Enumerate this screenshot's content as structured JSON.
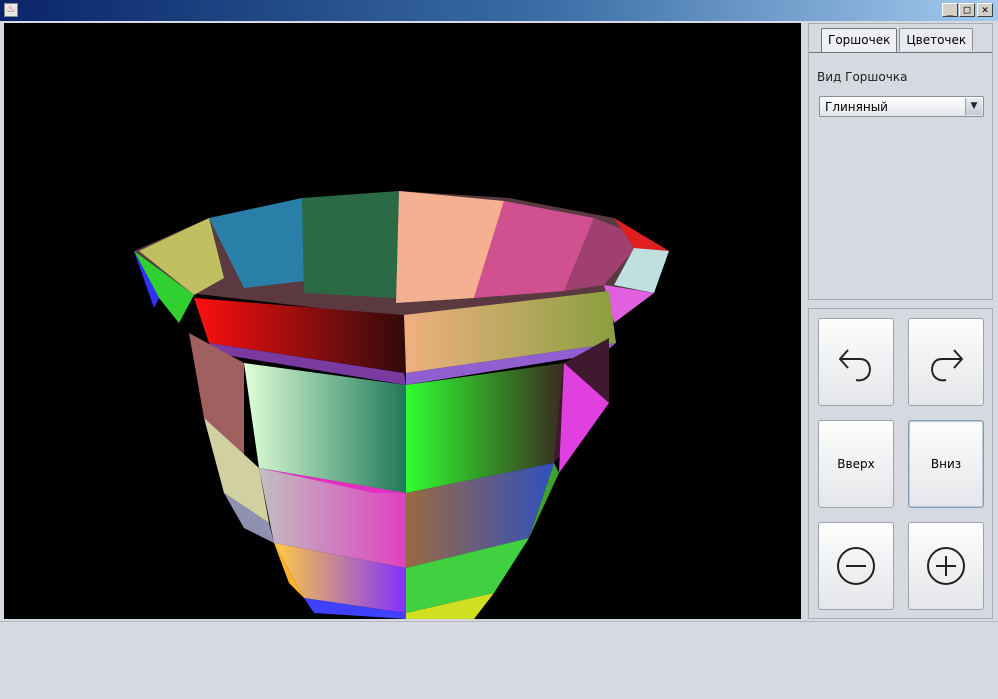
{
  "window": {
    "title": "",
    "app_icon": "java-cup-icon",
    "minimize": "_",
    "maximize": "□",
    "close": "✕"
  },
  "tabs": [
    {
      "label": "Горшочек",
      "active": true
    },
    {
      "label": "Цветочек",
      "active": false
    }
  ],
  "pot_panel": {
    "type_label": "Вид Горшочка",
    "type_value": "Глиняный"
  },
  "controls": {
    "rotate_left_icon": "rotate-left-icon",
    "rotate_right_icon": "rotate-right-icon",
    "up_label": "Вверх",
    "down_label": "Вниз",
    "zoom_out_icon": "zoom-out-icon",
    "zoom_in_icon": "zoom-in-icon"
  },
  "colors": {
    "canvas_background": "#000000",
    "panel_background": "#d6d9df",
    "title_gradient_start": "#0a246a"
  }
}
